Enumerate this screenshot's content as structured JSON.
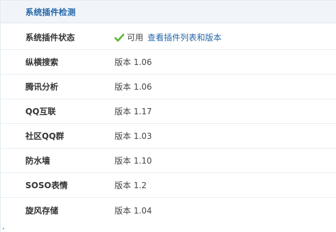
{
  "panel": {
    "title": "系统插件检测"
  },
  "status_row": {
    "label": "系统插件状态",
    "status_text": "可用",
    "link_text": "查看插件列表和版本",
    "status_icon": "check-icon",
    "status_color": "#5ab52b"
  },
  "plugins": [
    {
      "name": "纵横搜索",
      "version": "版本 1.06"
    },
    {
      "name": "腾讯分析",
      "version": "版本 1.06"
    },
    {
      "name": "QQ互联",
      "version": "版本 1.17"
    },
    {
      "name": "社区QQ群",
      "version": "版本 1.03"
    },
    {
      "name": "防水墙",
      "version": "版本 1.10"
    },
    {
      "name": "SOSO表情",
      "version": "版本 1.2"
    },
    {
      "name": "旋风存储",
      "version": "版本 1.04"
    }
  ],
  "colors": {
    "title": "#2366a8",
    "link": "#2366a8",
    "header_bg": "#f1f5fa"
  }
}
